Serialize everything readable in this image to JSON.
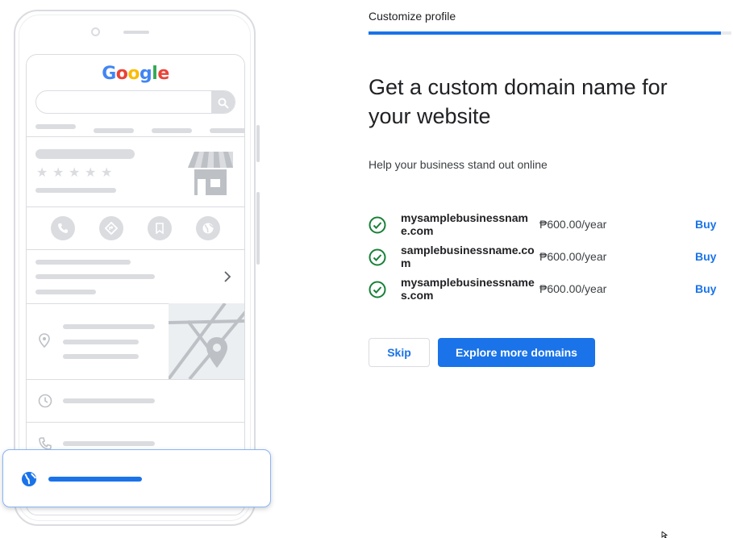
{
  "illustration": {
    "google_logo": [
      "G",
      "o",
      "o",
      "g",
      "l",
      "e"
    ],
    "google_logo_colors": [
      "#4285F4",
      "#EA4335",
      "#FBBC05",
      "#4285F4",
      "#34A853",
      "#EA4335"
    ],
    "icons": [
      "search-icon",
      "star-icon",
      "storefront-icon",
      "phone-icon",
      "directions-icon",
      "bookmark-icon",
      "globe-icon",
      "chevron-right-icon",
      "location-pin-icon",
      "map-icon",
      "clock-icon"
    ]
  },
  "header": {
    "step_title": "Customize profile",
    "progress": 0.97
  },
  "main": {
    "headline": "Get a custom domain name for your website",
    "subtitle": "Help your business stand out online",
    "domains": [
      {
        "name": "mysamplebusinessname.com",
        "price": "₱600.00/year",
        "action": "Buy"
      },
      {
        "name": "samplebusinessname.com",
        "price": "₱600.00/year",
        "action": "Buy"
      },
      {
        "name": "mysamplebusinessnames.com",
        "price": "₱600.00/year",
        "action": "Buy"
      }
    ]
  },
  "actions": {
    "skip_label": "Skip",
    "explore_label": "Explore more domains"
  },
  "colors": {
    "accent": "#1a73e8",
    "check_green": "#188038",
    "illustration_grey": "#dadce0"
  }
}
